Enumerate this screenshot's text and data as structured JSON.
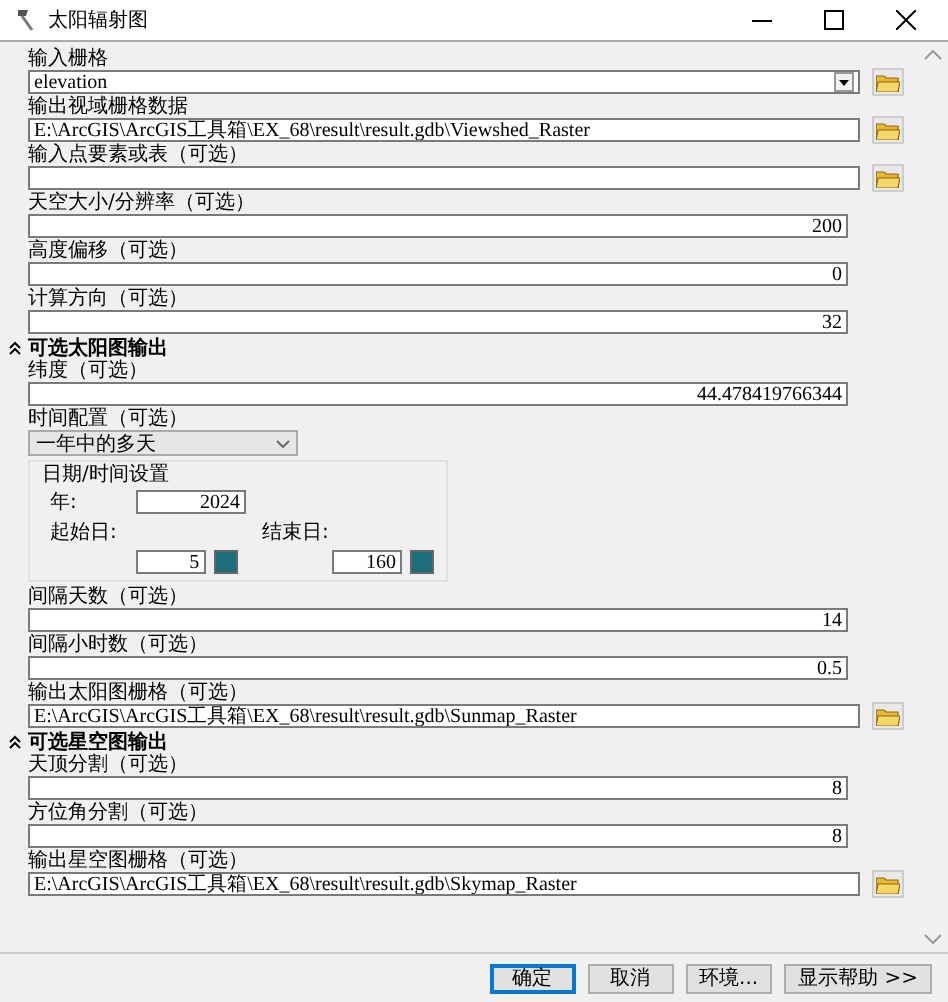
{
  "window": {
    "title": "太阳辐射图"
  },
  "params": [
    {
      "kind": "combo",
      "label": "输入栅格",
      "value": "elevation"
    },
    {
      "kind": "path",
      "label": "输出视域栅格数据",
      "value": "E:\\ArcGIS\\ArcGIS工具箱\\EX_68\\result\\result.gdb\\Viewshed_Raster"
    },
    {
      "kind": "path",
      "label": "输入点要素或表（可选）"
    },
    {
      "kind": "number",
      "label": "天空大小/分辨率（可选）",
      "value": "200"
    },
    {
      "kind": "number",
      "label": "高度偏移（可选）",
      "value": "0"
    },
    {
      "kind": "number",
      "label": "计算方向（可选）",
      "value": "32"
    },
    {
      "kind": "section",
      "label": "可选太阳图输出",
      "expanded": true
    },
    {
      "kind": "number",
      "label": "纬度（可选）",
      "value": "44.478419766344"
    },
    {
      "kind": "select",
      "label": "时间配置（可选）",
      "value": "一年中的多天"
    },
    {
      "kind": "datetime",
      "title": "日期/时间设置",
      "year_label": "年:",
      "year": "2024",
      "start_label": "起始日:",
      "start": "5",
      "end_label": "结束日:",
      "end": "160"
    },
    {
      "kind": "number",
      "label": "间隔天数（可选）",
      "value": "14"
    },
    {
      "kind": "number",
      "label": "间隔小时数（可选）",
      "value": "0.5"
    },
    {
      "kind": "path",
      "label": "输出太阳图栅格（可选）",
      "value": "E:\\ArcGIS\\ArcGIS工具箱\\EX_68\\result\\result.gdb\\Sunmap_Raster"
    },
    {
      "kind": "section",
      "label": "可选星空图输出",
      "expanded": true
    },
    {
      "kind": "number",
      "label": "天顶分割（可选）",
      "value": "8"
    },
    {
      "kind": "number",
      "label": "方位角分割（可选）",
      "value": "8"
    },
    {
      "kind": "path",
      "label": "输出星空图栅格（可选）",
      "value": "E:\\ArcGIS\\ArcGIS工具箱\\EX_68\\result\\result.gdb\\Skymap_Raster"
    }
  ],
  "buttons": [
    {
      "label": "确定",
      "default": true
    },
    {
      "label": "取消",
      "default": false
    },
    {
      "label": "环境...",
      "default": false
    },
    {
      "label": "显示帮助 >>",
      "default": false
    }
  ]
}
